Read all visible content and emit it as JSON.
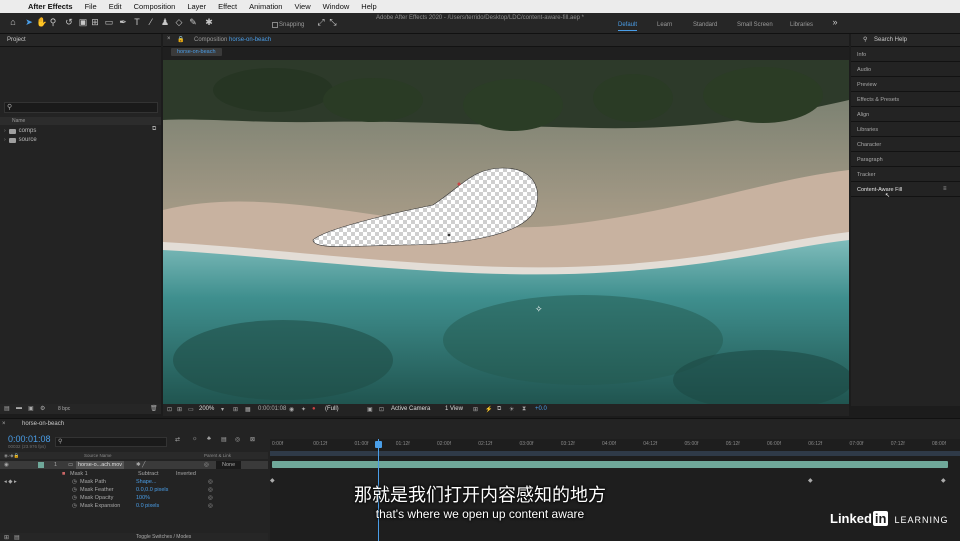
{
  "menubar": {
    "items": [
      "After Effects",
      "File",
      "Edit",
      "Composition",
      "Layer",
      "Effect",
      "Animation",
      "View",
      "Window",
      "Help"
    ]
  },
  "toolbar": {
    "title": "Adobe After Effects 2020 - /Users/terrido/Desktop/LDC/content-aware-fill.aep *",
    "snapping": "Snapping",
    "workspaces": [
      "Default",
      "Learn",
      "Standard",
      "Small Screen",
      "Libraries"
    ]
  },
  "project": {
    "title": "Project",
    "column_name": "Name",
    "folders": [
      "comps",
      "source"
    ],
    "bpc": "8 bpc"
  },
  "composition": {
    "title_prefix": "Composition",
    "title_name": "horse-on-beach",
    "tab": "horse-on-beach",
    "zoom": "200%",
    "timecode": "0:00:01:08",
    "resolution": "(Full)",
    "camera": "Active Camera",
    "view": "1 View",
    "exposure": "+0.0"
  },
  "right_panels": {
    "search": "Search Help",
    "items": [
      "Info",
      "Audio",
      "Preview",
      "Effects & Presets",
      "Align",
      "Libraries",
      "Character",
      "Paragraph",
      "Tracker",
      "Content-Aware Fill"
    ]
  },
  "timeline": {
    "tab": "horse-on-beach",
    "timecode": "0:00:01:08",
    "timecode_sub": "00032 (23.976 fps)",
    "columns": {
      "source": "Source Name",
      "parent": "Parent & Link"
    },
    "layer": {
      "index": "1",
      "name": "horse-o...ach.mov",
      "parent": "None"
    },
    "mask": {
      "name": "Mask 1",
      "mode": "Subtract",
      "inverted": "Inverted"
    },
    "properties": [
      {
        "label": "Mask Path",
        "value": "Shape..."
      },
      {
        "label": "Mask Feather",
        "value": "0.0,0.0 pixels"
      },
      {
        "label": "Mask Opacity",
        "value": "100%"
      },
      {
        "label": "Mask Expansion",
        "value": "0.0 pixels"
      }
    ],
    "ruler": [
      "0:00f",
      "00:12f",
      "01:00f",
      "01:12f",
      "02:00f",
      "02:12f",
      "03:00f",
      "03:12f",
      "04:00f",
      "04:12f",
      "05:00f",
      "05:12f",
      "06:00f",
      "06:12f",
      "07:00f",
      "07:12f",
      "08:00f"
    ],
    "toggle": "Toggle Switches / Modes"
  },
  "subtitles": {
    "zh": "那就是我们打开内容感知的地方",
    "en": "that's where we open up content aware"
  },
  "watermark": {
    "linked": "Linked",
    "in": "in",
    "learning": "LEARNING"
  }
}
